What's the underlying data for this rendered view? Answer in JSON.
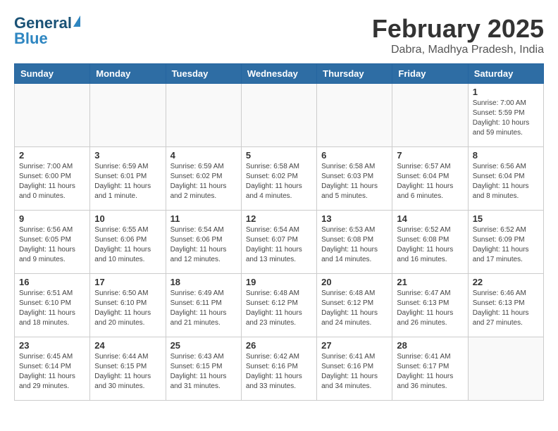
{
  "header": {
    "logo_line1": "General",
    "logo_line2": "Blue",
    "title": "February 2025",
    "subtitle": "Dabra, Madhya Pradesh, India"
  },
  "calendar": {
    "days_of_week": [
      "Sunday",
      "Monday",
      "Tuesday",
      "Wednesday",
      "Thursday",
      "Friday",
      "Saturday"
    ],
    "weeks": [
      [
        {
          "day": "",
          "info": ""
        },
        {
          "day": "",
          "info": ""
        },
        {
          "day": "",
          "info": ""
        },
        {
          "day": "",
          "info": ""
        },
        {
          "day": "",
          "info": ""
        },
        {
          "day": "",
          "info": ""
        },
        {
          "day": "1",
          "info": "Sunrise: 7:00 AM\nSunset: 5:59 PM\nDaylight: 10 hours\nand 59 minutes."
        }
      ],
      [
        {
          "day": "2",
          "info": "Sunrise: 7:00 AM\nSunset: 6:00 PM\nDaylight: 11 hours\nand 0 minutes."
        },
        {
          "day": "3",
          "info": "Sunrise: 6:59 AM\nSunset: 6:01 PM\nDaylight: 11 hours\nand 1 minute."
        },
        {
          "day": "4",
          "info": "Sunrise: 6:59 AM\nSunset: 6:02 PM\nDaylight: 11 hours\nand 2 minutes."
        },
        {
          "day": "5",
          "info": "Sunrise: 6:58 AM\nSunset: 6:02 PM\nDaylight: 11 hours\nand 4 minutes."
        },
        {
          "day": "6",
          "info": "Sunrise: 6:58 AM\nSunset: 6:03 PM\nDaylight: 11 hours\nand 5 minutes."
        },
        {
          "day": "7",
          "info": "Sunrise: 6:57 AM\nSunset: 6:04 PM\nDaylight: 11 hours\nand 6 minutes."
        },
        {
          "day": "8",
          "info": "Sunrise: 6:56 AM\nSunset: 6:04 PM\nDaylight: 11 hours\nand 8 minutes."
        }
      ],
      [
        {
          "day": "9",
          "info": "Sunrise: 6:56 AM\nSunset: 6:05 PM\nDaylight: 11 hours\nand 9 minutes."
        },
        {
          "day": "10",
          "info": "Sunrise: 6:55 AM\nSunset: 6:06 PM\nDaylight: 11 hours\nand 10 minutes."
        },
        {
          "day": "11",
          "info": "Sunrise: 6:54 AM\nSunset: 6:06 PM\nDaylight: 11 hours\nand 12 minutes."
        },
        {
          "day": "12",
          "info": "Sunrise: 6:54 AM\nSunset: 6:07 PM\nDaylight: 11 hours\nand 13 minutes."
        },
        {
          "day": "13",
          "info": "Sunrise: 6:53 AM\nSunset: 6:08 PM\nDaylight: 11 hours\nand 14 minutes."
        },
        {
          "day": "14",
          "info": "Sunrise: 6:52 AM\nSunset: 6:08 PM\nDaylight: 11 hours\nand 16 minutes."
        },
        {
          "day": "15",
          "info": "Sunrise: 6:52 AM\nSunset: 6:09 PM\nDaylight: 11 hours\nand 17 minutes."
        }
      ],
      [
        {
          "day": "16",
          "info": "Sunrise: 6:51 AM\nSunset: 6:10 PM\nDaylight: 11 hours\nand 18 minutes."
        },
        {
          "day": "17",
          "info": "Sunrise: 6:50 AM\nSunset: 6:10 PM\nDaylight: 11 hours\nand 20 minutes."
        },
        {
          "day": "18",
          "info": "Sunrise: 6:49 AM\nSunset: 6:11 PM\nDaylight: 11 hours\nand 21 minutes."
        },
        {
          "day": "19",
          "info": "Sunrise: 6:48 AM\nSunset: 6:12 PM\nDaylight: 11 hours\nand 23 minutes."
        },
        {
          "day": "20",
          "info": "Sunrise: 6:48 AM\nSunset: 6:12 PM\nDaylight: 11 hours\nand 24 minutes."
        },
        {
          "day": "21",
          "info": "Sunrise: 6:47 AM\nSunset: 6:13 PM\nDaylight: 11 hours\nand 26 minutes."
        },
        {
          "day": "22",
          "info": "Sunrise: 6:46 AM\nSunset: 6:13 PM\nDaylight: 11 hours\nand 27 minutes."
        }
      ],
      [
        {
          "day": "23",
          "info": "Sunrise: 6:45 AM\nSunset: 6:14 PM\nDaylight: 11 hours\nand 29 minutes."
        },
        {
          "day": "24",
          "info": "Sunrise: 6:44 AM\nSunset: 6:15 PM\nDaylight: 11 hours\nand 30 minutes."
        },
        {
          "day": "25",
          "info": "Sunrise: 6:43 AM\nSunset: 6:15 PM\nDaylight: 11 hours\nand 31 minutes."
        },
        {
          "day": "26",
          "info": "Sunrise: 6:42 AM\nSunset: 6:16 PM\nDaylight: 11 hours\nand 33 minutes."
        },
        {
          "day": "27",
          "info": "Sunrise: 6:41 AM\nSunset: 6:16 PM\nDaylight: 11 hours\nand 34 minutes."
        },
        {
          "day": "28",
          "info": "Sunrise: 6:41 AM\nSunset: 6:17 PM\nDaylight: 11 hours\nand 36 minutes."
        },
        {
          "day": "",
          "info": ""
        }
      ]
    ]
  }
}
